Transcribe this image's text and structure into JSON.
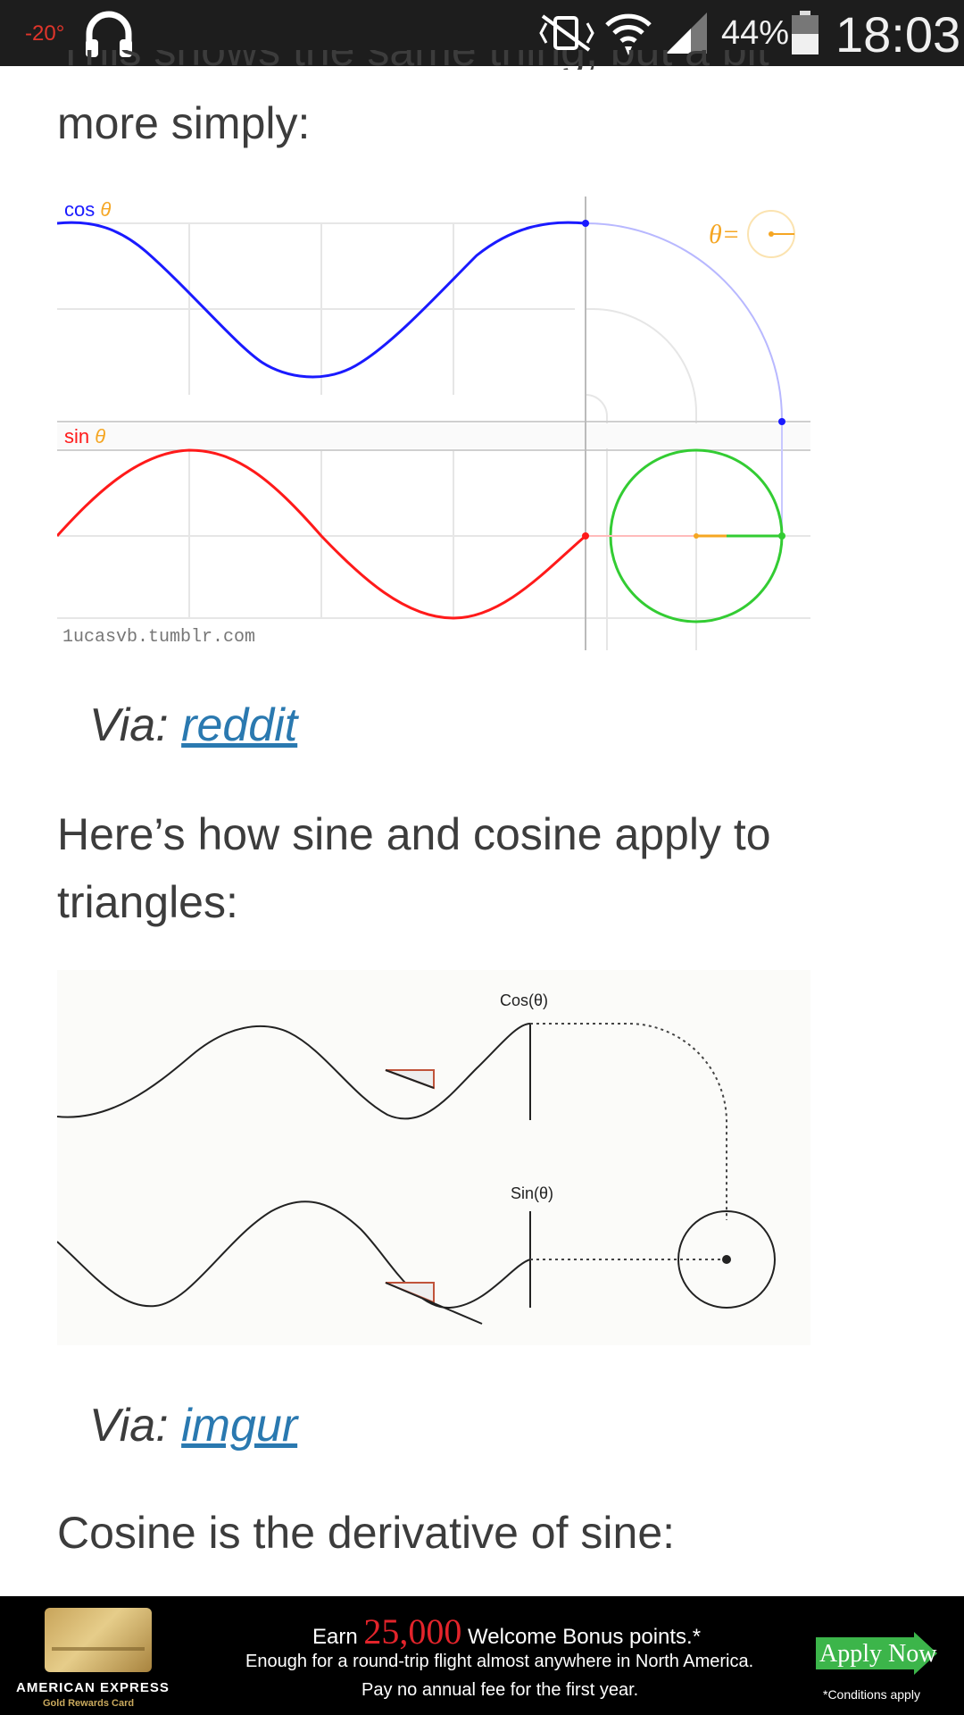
{
  "status_bar": {
    "temperature": "-20°",
    "battery_percent": "44%",
    "time": "18:03"
  },
  "article": {
    "cut_line": "This shows the same thing, but a bit",
    "intro_line": "more simply:",
    "via1_prefix": "Via: ",
    "via1_link": "reddit",
    "para2": "Here’s how sine and cosine apply to triangles:",
    "via2_prefix": "Via: ",
    "via2_link": "imgur",
    "para3": "Cosine is the derivative of sine:"
  },
  "figure1": {
    "cos_label": "cos",
    "sin_label": "sin",
    "theta": "θ",
    "theta_eq": "θ=",
    "watermark": "1ucasvb.tumblr.com",
    "colors": {
      "cos": "#1a1aff",
      "sin": "#ff1a1a",
      "circle": "#33cc33",
      "theta": "#f5a623"
    }
  },
  "figure2": {
    "cos_label": "Cos(θ)",
    "sin_label": "Sin(θ)"
  },
  "ad": {
    "earn_prefix": "Earn ",
    "earn_amount": "25,000",
    "earn_suffix": " Welcome Bonus points.*",
    "line2": "Enough for a round-trip flight almost anywhere in North America.",
    "line3": "Pay no annual fee for the first year.",
    "brand": "AMERICAN EXPRESS",
    "card_name": "Gold Rewards Card",
    "apply": "Apply Now",
    "conditions": "*Conditions apply",
    "colors": {
      "amount": "#e3242b",
      "apply_bg": "#3cb54a"
    }
  }
}
